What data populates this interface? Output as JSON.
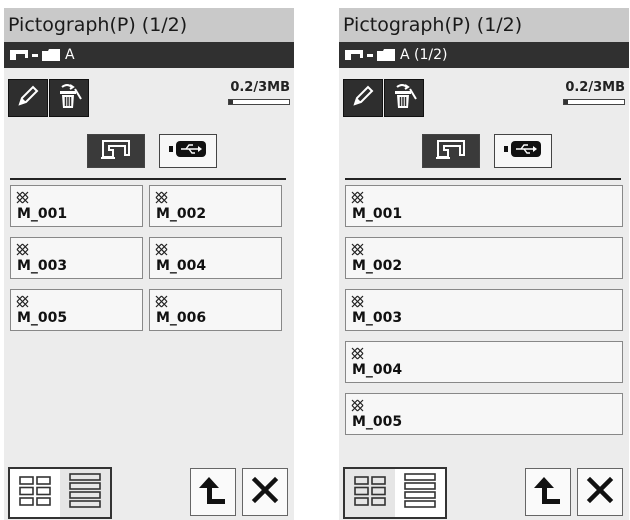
{
  "left": {
    "title": "Pictograph(P) (1/2)",
    "path": "A",
    "memory": {
      "text": "0.2/3MB",
      "used_fraction": 0.07
    },
    "view_mode": "grid",
    "files": [
      "M_001",
      "M_002",
      "M_003",
      "M_004",
      "M_005",
      "M_006"
    ]
  },
  "right": {
    "title": "Pictograph(P) (1/2)",
    "path": "A (1/2)",
    "memory": {
      "text": "0.2/3MB",
      "used_fraction": 0.07
    },
    "view_mode": "list",
    "files": [
      "M_001",
      "M_002",
      "M_003",
      "M_004",
      "M_005"
    ]
  },
  "icons": {
    "edit": "pencil-icon",
    "delete": "trash-icon",
    "machine": "sewing-machine-icon",
    "usb": "usb-icon",
    "folder": "folder-icon",
    "stitch": "cross-stitch-icon",
    "back": "back-arrow-icon",
    "close": "close-icon",
    "grid": "grid-view-icon",
    "list": "list-view-icon"
  },
  "colors": {
    "title_bg": "#c9c9c9",
    "path_bg": "#303030",
    "panel_bg": "#ececec",
    "button_bg": "#f7f7f7",
    "dark_button": "#2e2e2e"
  }
}
